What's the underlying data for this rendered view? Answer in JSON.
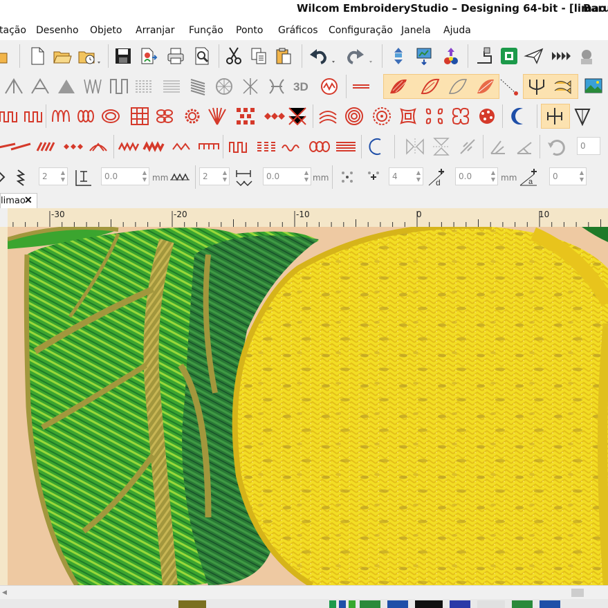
{
  "window": {
    "title": "Wilcom EmbroideryStudio – Designing 64-bit - [limao",
    "user": "Baru"
  },
  "menu": {
    "items": [
      {
        "id": "m0",
        "label": "tação"
      },
      {
        "id": "m1",
        "label": "Desenho"
      },
      {
        "id": "m2",
        "label": "Objeto"
      },
      {
        "id": "m3",
        "label": "Arranjar"
      },
      {
        "id": "m4",
        "label": "Função"
      },
      {
        "id": "m5",
        "label": "Ponto"
      },
      {
        "id": "m6",
        "label": "Gráficos"
      },
      {
        "id": "m7",
        "label": "Configuração"
      },
      {
        "id": "m8",
        "label": "Janela"
      },
      {
        "id": "m9",
        "label": "Ajuda"
      }
    ]
  },
  "properties_bar": {
    "stitch_count_1": "2",
    "angle_1": "0.0",
    "unit_1": "mm",
    "stitch_count_2": "2",
    "angle_2": "0.0",
    "unit_2": "mm",
    "count_3": "4",
    "offset_d": "0.0",
    "unit_3": "mm",
    "value_4": "0",
    "toolbar_value": "0"
  },
  "document_tab": {
    "label": "limao",
    "close_symbol": "✕"
  },
  "ruler": {
    "labels": [
      {
        "id": "r1",
        "text": "-30"
      },
      {
        "id": "r2",
        "text": "-20"
      },
      {
        "id": "r3",
        "text": "-10"
      },
      {
        "id": "r4",
        "text": "0"
      },
      {
        "id": "r5",
        "text": "10"
      }
    ]
  },
  "colors": {
    "accent_red": "#d53a2b",
    "accent_blue": "#1f4fa8",
    "highlight": "#fce2b0",
    "lemon_yellow": "#f3de24",
    "leaf_green": "#37a82e",
    "leaf_dark_green": "#24692c",
    "vein_olive": "#a2973d",
    "background_peach": "#eec9a2"
  },
  "icons": {
    "file": [
      "open-folder-icon",
      "new-document-icon",
      "open-icon",
      "open-recent-icon",
      "save-icon",
      "save-as-icon",
      "print-icon",
      "print-preview-icon",
      "cut-icon",
      "copy-icon",
      "paste-icon",
      "undo-icon",
      "redo-icon",
      "travel-icon",
      "stitch-player-icon",
      "color-blend-icon",
      "export-machine-icon",
      "send-icon",
      "send-paper-icon",
      "fast-forward-icon",
      "hoop-icon"
    ],
    "digitize": [
      "fill-input-icon",
      "run-input-icon",
      "column-input-icon",
      "zigzag-input-icon",
      "outline-icon",
      "tatami-fill-icon",
      "lines-icon",
      "satin-fill-icon",
      "circle-fill-icon",
      "corners-icon",
      "buttonhole-icon",
      "3d-foam-icon",
      "stamp-icon",
      "frame-icon",
      "satin-highlight-icon",
      "leaf-icon",
      "leaf-fill-icon",
      "trace-icon",
      "hook-icon",
      "fish-icon",
      "picture-icon"
    ],
    "effects": [
      "zigzag-effect-icon",
      "wave-effect-icon",
      "chain-effect-icon",
      "cross-stitch-icon",
      "oval-effect-icon",
      "circle-effect-icon",
      "grid-effect-icon",
      "pattern-effect-icon",
      "diamond-effect-icon",
      "x-effect-icon",
      "arch-effect-icon",
      "spiral-effect-icon",
      "target-effect-icon",
      "square-effect-icon",
      "motif-effect-icon",
      "flower-effect-icon",
      "crescent-icon",
      "stitch-angle-icon",
      "down-arrow-icon"
    ],
    "edges": [
      "edge-icon",
      "run-edge-icon",
      "satin-edge-icon",
      "diamond-edge-icon",
      "fan-edge-icon",
      "zigzag-edge-icon",
      "wave-edge-icon",
      "blanket-edge-icon",
      "scallop-edge-icon",
      "chain-edge-icon",
      "crescent-edge-icon",
      "mirror-icon",
      "flip-icon",
      "rotate-icon",
      "slant-icon",
      "skew-icon",
      "rotate-back-icon"
    ]
  }
}
